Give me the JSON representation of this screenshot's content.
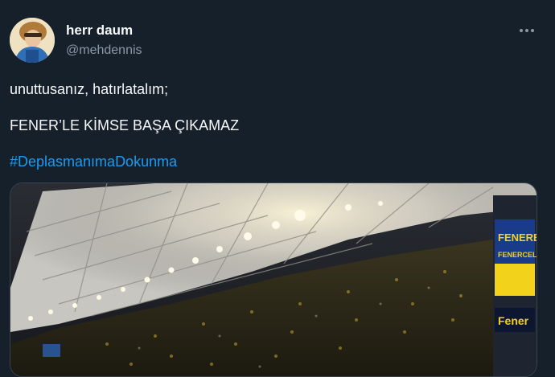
{
  "author": {
    "display_name": "herr daum",
    "handle": "@mehdennis"
  },
  "tweet": {
    "line1": "unuttusanız, hatırlatalım;",
    "line2": "FENER’LE KİMSE BAŞA ÇIKAMAZ",
    "hashtag": "#DeplasmanımaDokunma"
  },
  "media": {
    "banner_top": "FENERB",
    "banner_mid": "FENERCELL'LE",
    "banner_bottom": "Fener"
  },
  "icons": {
    "more": "more-horizontal-icon",
    "avatar": "profile-avatar"
  },
  "colors": {
    "background": "#15202b",
    "primary_text": "#f7f9f9",
    "secondary_text": "#8b98a5",
    "link": "#1d9bf0"
  }
}
